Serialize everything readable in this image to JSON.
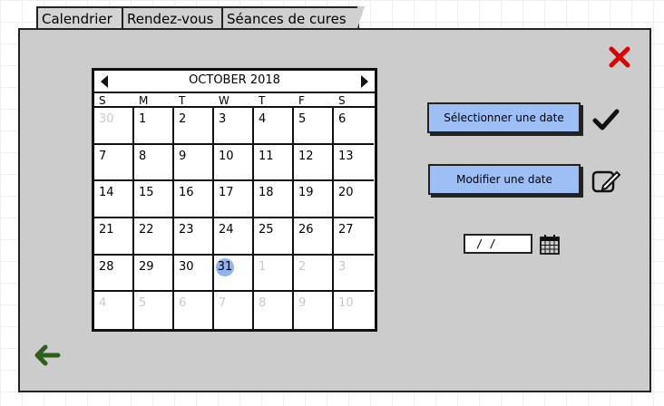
{
  "tabs": [
    {
      "label": "Calendrier"
    },
    {
      "label": "Rendez-vous"
    },
    {
      "label": "Séances de cures"
    }
  ],
  "calendar": {
    "month_title": "OCTOBER 2018",
    "weekdays": [
      "S",
      "M",
      "T",
      "W",
      "T",
      "F",
      "S"
    ],
    "weeks": [
      [
        "30",
        "1",
        "2",
        "3",
        "4",
        "5",
        "6"
      ],
      [
        "7",
        "8",
        "9",
        "10",
        "11",
        "12",
        "13"
      ],
      [
        "14",
        "15",
        "16",
        "17",
        "18",
        "19",
        "20"
      ],
      [
        "21",
        "22",
        "23",
        "24",
        "25",
        "26",
        "27"
      ],
      [
        "28",
        "29",
        "30",
        "31",
        "1",
        "2",
        "3"
      ],
      [
        "4",
        "5",
        "6",
        "7",
        "8",
        "9",
        "10"
      ]
    ],
    "highlighted_day": "31"
  },
  "buttons": {
    "select_date": "Sélectionner une date",
    "modify_date": "Modifier une date"
  },
  "date_field": {
    "value": "/ /"
  },
  "icons": {
    "close": "close-icon",
    "check": "checkmark-icon",
    "edit": "edit-icon",
    "calendar": "calendar-icon",
    "back": "back-arrow-icon"
  },
  "colors": {
    "panel": "#cccccc",
    "button": "#9ebff5",
    "close": "#dd0000",
    "back_arrow": "#2f5e1b",
    "highlight": "#8fb4ef"
  }
}
